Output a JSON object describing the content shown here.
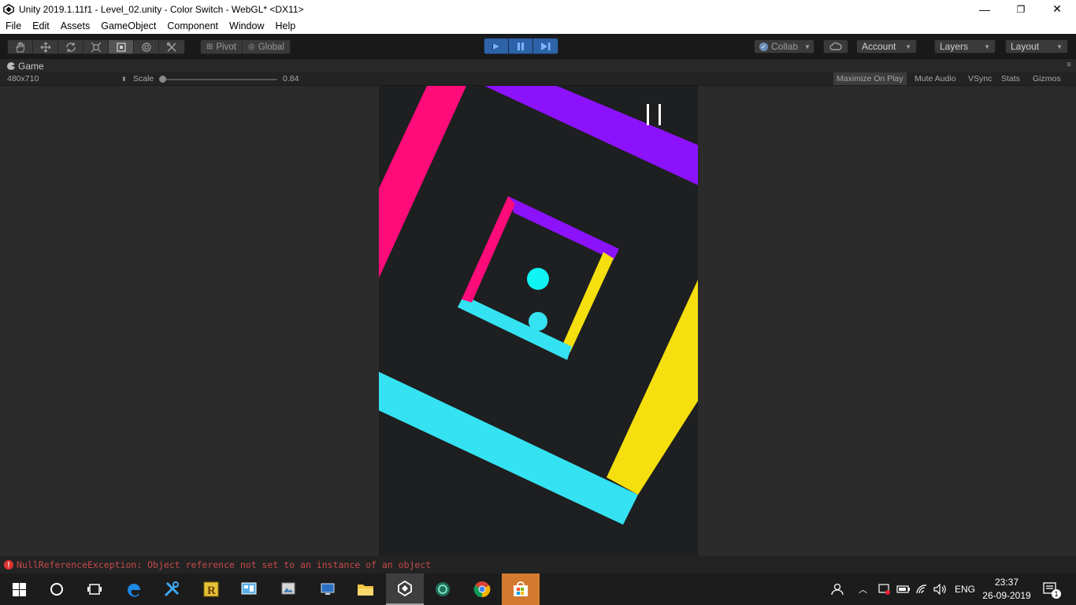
{
  "window": {
    "title": "Unity 2019.1.11f1 - Level_02.unity - Color Switch - WebGL* <DX11>",
    "minimize": "—",
    "restore": "❐",
    "close": "✕"
  },
  "menu": [
    "File",
    "Edit",
    "Assets",
    "GameObject",
    "Component",
    "Window",
    "Help"
  ],
  "toolbar": {
    "tools": [
      "hand-icon",
      "move-icon",
      "rotate-icon",
      "scale-icon",
      "rect-icon",
      "transform-icon",
      "custom-tool-icon"
    ],
    "pivot": "Pivot",
    "global": "Global",
    "collab": "Collab",
    "account": "Account",
    "layers": "Layers",
    "layout": "Layout"
  },
  "tab": {
    "label": "Game"
  },
  "gamebar": {
    "resolution": "480x710",
    "scale_label": "Scale",
    "scale_value": "0.84",
    "options": [
      "Maximize On Play",
      "Mute Audio",
      "VSync",
      "Stats",
      "Gizmos"
    ],
    "maximize_active": true
  },
  "game": {
    "colors": {
      "pink": "#ff0b7a",
      "purple": "#8c12fb",
      "yellow": "#f5df0e",
      "cyan": "#35e2f2",
      "background": "#1e1f20"
    },
    "pause_icon": "pause-icon"
  },
  "status": {
    "error": "NullReferenceException: Object reference not set to an instance of an object"
  },
  "taskbar": {
    "lang": "ENG",
    "time": "23:37",
    "date": "26-09-2019",
    "notifications": "1",
    "apps": [
      "windows-start-icon",
      "cortana-icon",
      "task-view-icon",
      "edge-icon",
      "tools-icon",
      "reshacker-icon",
      "control-panel-icon",
      "image-viewer-icon",
      "remote-desktop-icon",
      "file-explorer-icon",
      "unity-icon",
      "game-icon",
      "chrome-icon",
      "store-icon"
    ]
  }
}
